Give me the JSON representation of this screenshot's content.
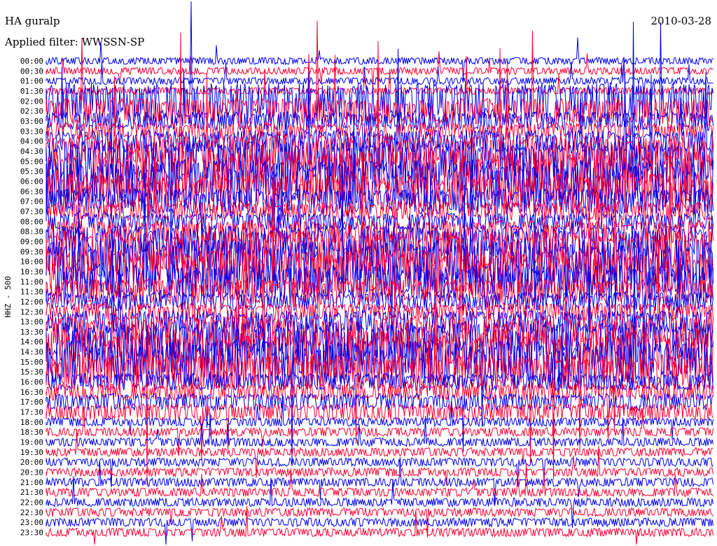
{
  "header": {
    "station": "HA guralp",
    "filter": "Applied filter: WWSSN-SP",
    "date": "2010-03-28"
  },
  "chart_data": {
    "type": "line",
    "title": "HA guralp",
    "subtitle": "Applied filter: WWSSN-SP",
    "date": "2010-03-28",
    "ylabel": "HHZ - 500",
    "xlabel": "",
    "row_interval_minutes": 30,
    "tick_labels": [
      "00:00",
      "00:30",
      "01:00",
      "01:30",
      "02:00",
      "02:30",
      "03:00",
      "03:30",
      "04:00",
      "04:30",
      "05:00",
      "05:30",
      "06:00",
      "06:30",
      "07:00",
      "07:30",
      "08:00",
      "08:30",
      "09:00",
      "09:30",
      "10:00",
      "10:30",
      "11:00",
      "11:30",
      "12:00",
      "12:30",
      "13:00",
      "13:30",
      "14:00",
      "14:30",
      "15:00",
      "15:30",
      "16:00",
      "16:30",
      "17:00",
      "17:30",
      "18:00",
      "18:30",
      "19:00",
      "19:30",
      "20:00",
      "20:30",
      "21:00",
      "21:30",
      "22:00",
      "22:30",
      "23:00",
      "23:30"
    ],
    "row_colors": [
      "#0000ee",
      "#ff0033"
    ],
    "series": [],
    "grid": false,
    "legend": "none"
  }
}
